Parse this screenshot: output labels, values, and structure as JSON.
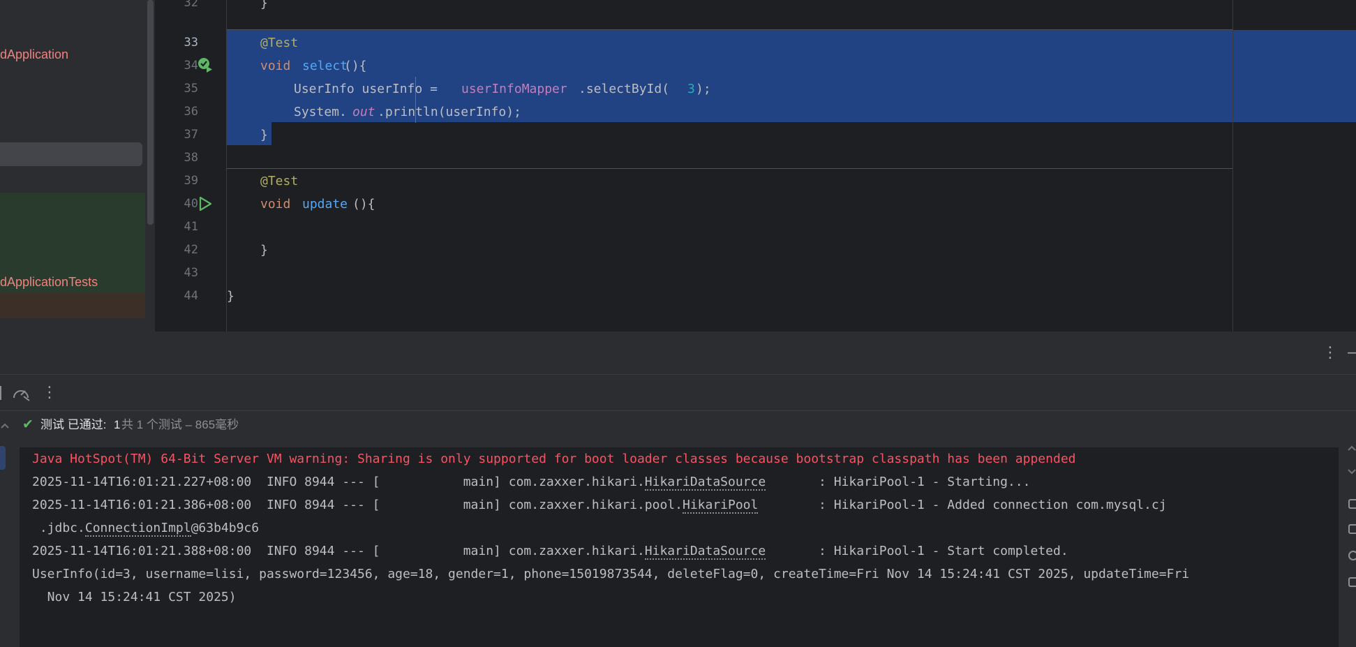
{
  "project_tree": {
    "item_main": "dApplication",
    "item_tests": "dApplicationTests"
  },
  "editor": {
    "line_numbers": [
      "32",
      "33",
      "34",
      "35",
      "36",
      "37",
      "38",
      "39",
      "40",
      "41",
      "42",
      "43",
      "44"
    ],
    "lines": {
      "l33_annotation": "@Test",
      "l34_void": "void",
      "l34_method": "select",
      "l34_rest": "(){",
      "l35_type": "UserInfo userInfo = ",
      "l35_field": "userInfoMapper",
      "l35_call": ".selectById(",
      "l35_arg": "3",
      "l35_end": ");",
      "l36_system": "System.",
      "l36_out": "out",
      "l36_rest": ".println(userInfo);",
      "l37_brace": "}",
      "l39_annotation": "@Test",
      "l40_void": "void",
      "l40_method": "update",
      "l40_rest": "(){",
      "l42_brace": "}",
      "l44_brace": "}"
    }
  },
  "toolwindow": {
    "header_more": "⋮",
    "header_minimize": "—",
    "toolbar_more": "⋮",
    "status": {
      "check": "✔",
      "label": "测试 已通过: ",
      "count": "1",
      "detail": "共 1 个测试 – 865毫秒"
    },
    "console": {
      "l1": "Java HotSpot(TM) 64-Bit Server VM warning: Sharing is only supported for boot loader classes because bootstrap classpath has been appended",
      "l2_pre": "2025-11-14T16:01:21.227+08:00  INFO 8944 --- [           main] com.zaxxer.hikari.",
      "l2_cls": "HikariDataSource",
      "l2_post": "       : HikariPool-1 - Starting...",
      "l3_pre": "2025-11-14T16:01:21.386+08:00  INFO 8944 --- [           main] com.zaxxer.hikari.pool.",
      "l3_cls": "HikariPool",
      "l3_post": "        : HikariPool-1 - Added connection com.mysql.cj",
      "l4_pre": " .jdbc.",
      "l4_cls": "ConnectionImpl",
      "l4_post": "@63b4b9c6",
      "l5_pre": "2025-11-14T16:01:21.388+08:00  INFO 8944 --- [           main] com.zaxxer.hikari.",
      "l5_cls": "HikariDataSource",
      "l5_post": "       : HikariPool-1 - Start completed.",
      "l6": "UserInfo(id=3, username=lisi, password=123456, age=18, gender=1, phone=15019873544, deleteFlag=0, createTime=Fri Nov 14 15:24:41 CST 2025, updateTime=Fri",
      "l7": "  Nov 14 15:24:41 CST 2025)"
    }
  },
  "colors": {
    "selection": "#214283",
    "error_text": "#f75464",
    "pass_green": "#5fb865"
  }
}
